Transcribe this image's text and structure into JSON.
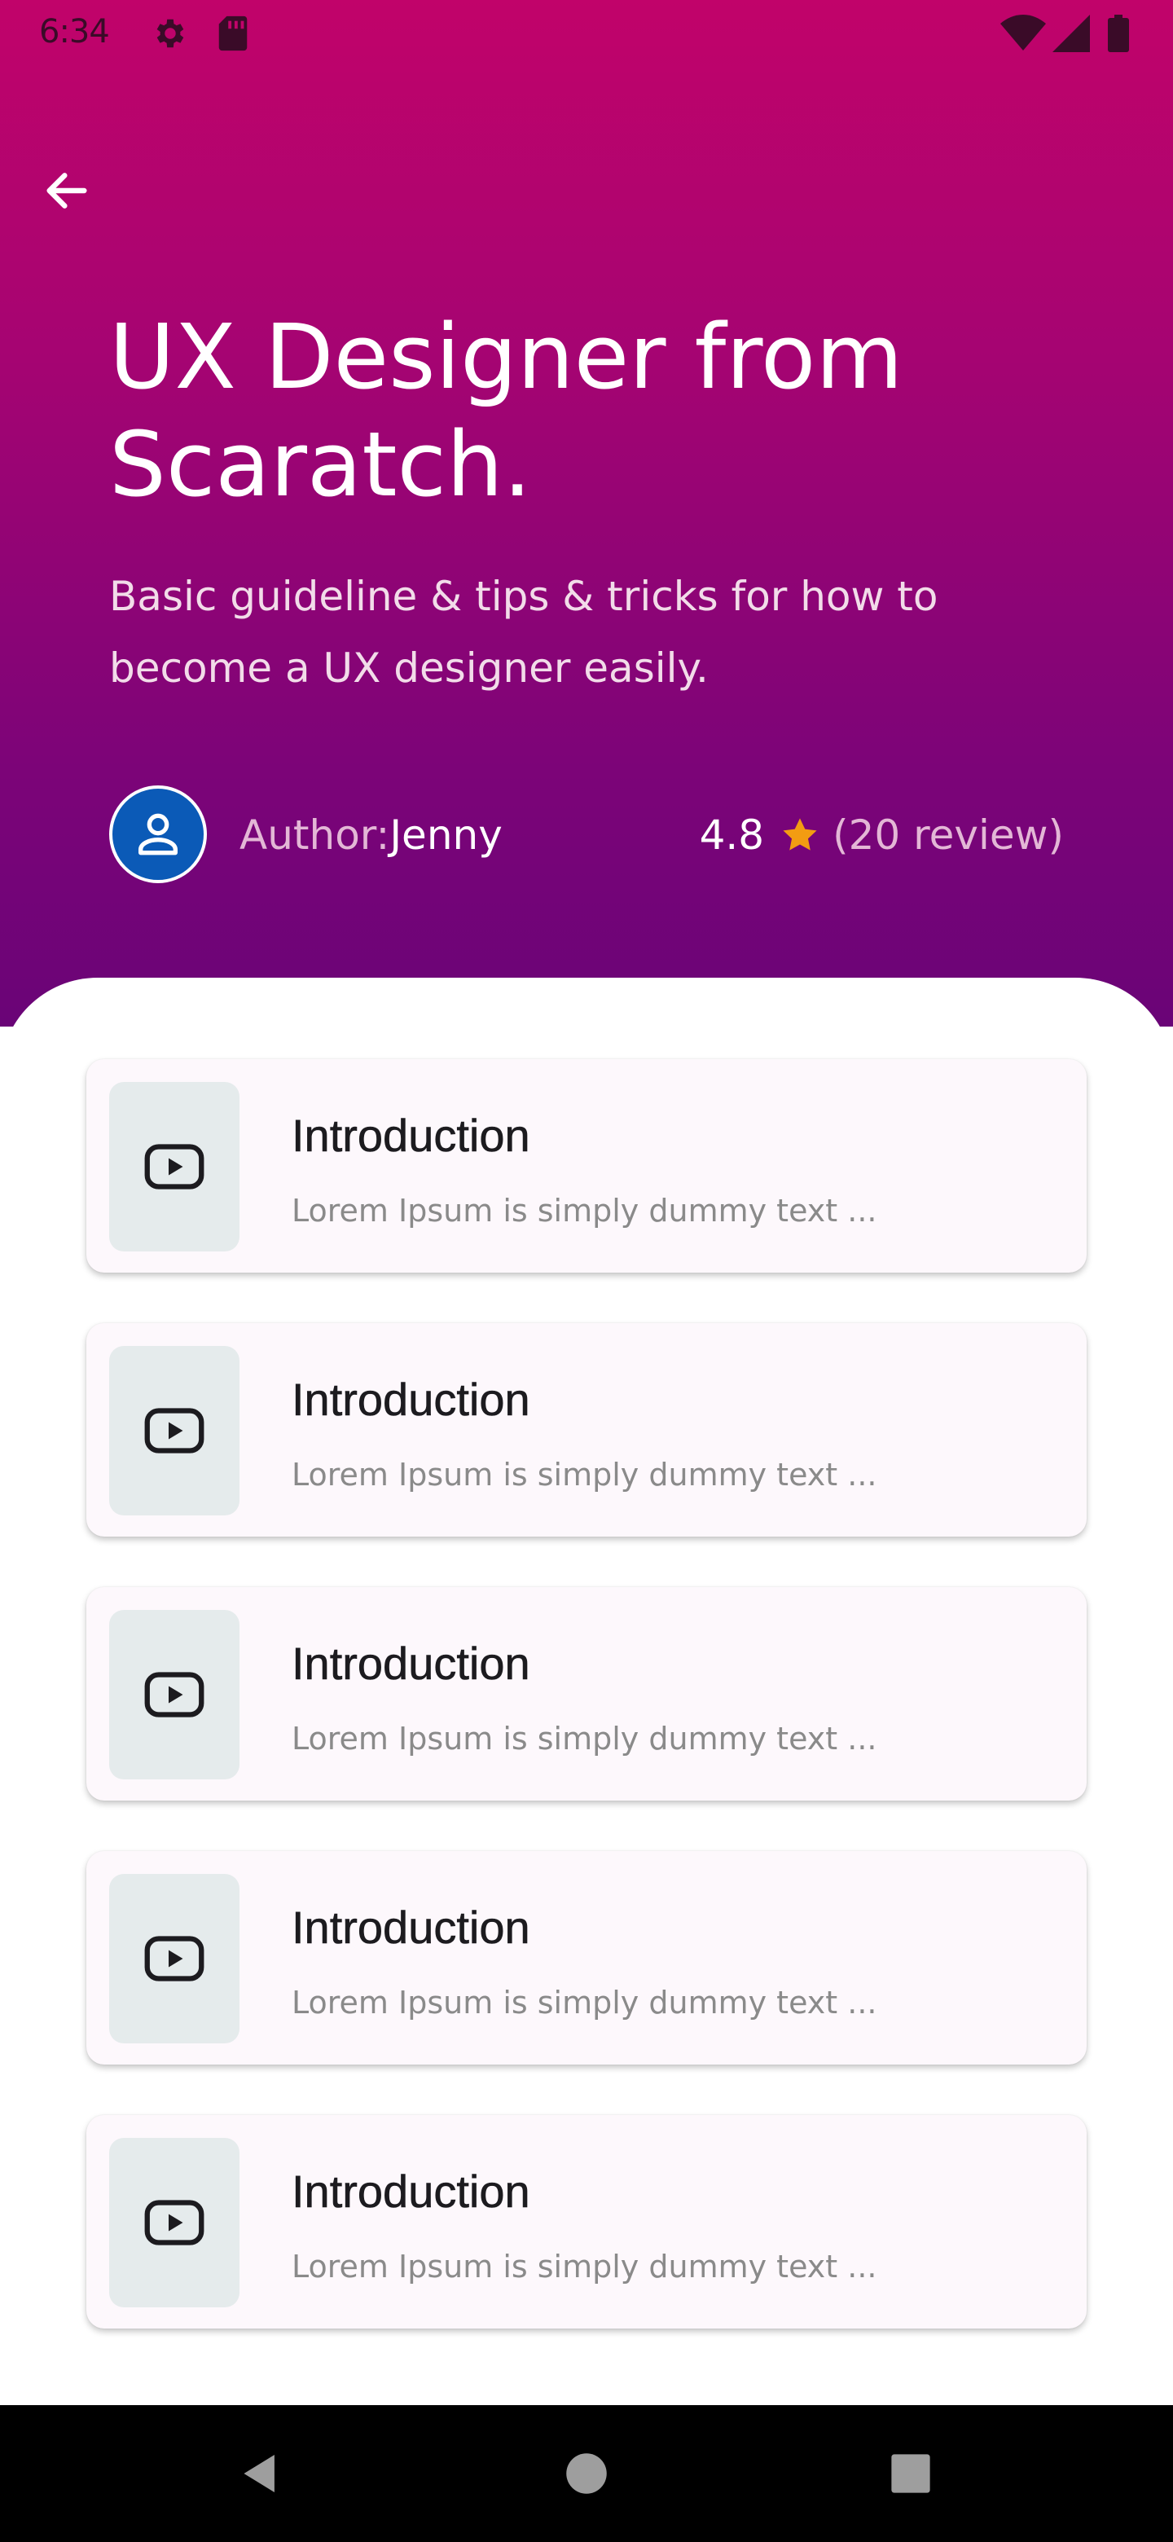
{
  "status_bar": {
    "time": "6:34",
    "left_icons": [
      "gear-icon",
      "sd-card-icon"
    ],
    "right_icons": [
      "wifi-icon",
      "signal-icon",
      "battery-icon"
    ]
  },
  "header": {
    "back_icon": "arrow-left-icon",
    "title": "UX Designer from Scaratch.",
    "subtitle": "Basic guideline & tips & tricks for how to become a UX designer easily.",
    "author_label": "Author:",
    "author_name": "Jenny",
    "rating_value": "4.8",
    "rating_count": "(20 review)"
  },
  "colors": {
    "gradient_top": "#c1036a",
    "gradient_bottom": "#6a0477",
    "avatar_bg": "#0b5ab7",
    "star": "#f39c12",
    "card_bg": "#fdf8fc",
    "thumb_bg": "#e5ebec"
  },
  "lessons": [
    {
      "title": "Introduction",
      "description": "Lorem Ipsum is simply dummy text ...",
      "icon": "play-icon"
    },
    {
      "title": "Introduction",
      "description": "Lorem Ipsum is simply dummy text ...",
      "icon": "play-icon"
    },
    {
      "title": "Introduction",
      "description": "Lorem Ipsum is simply dummy text ...",
      "icon": "play-icon"
    },
    {
      "title": "Introduction",
      "description": "Lorem Ipsum is simply dummy text ...",
      "icon": "play-icon"
    },
    {
      "title": "Introduction",
      "description": "Lorem Ipsum is simply dummy text ...",
      "icon": "play-icon"
    }
  ],
  "nav_bar": {
    "buttons": [
      "back-triangle-icon",
      "home-circle-icon",
      "recents-square-icon"
    ]
  }
}
